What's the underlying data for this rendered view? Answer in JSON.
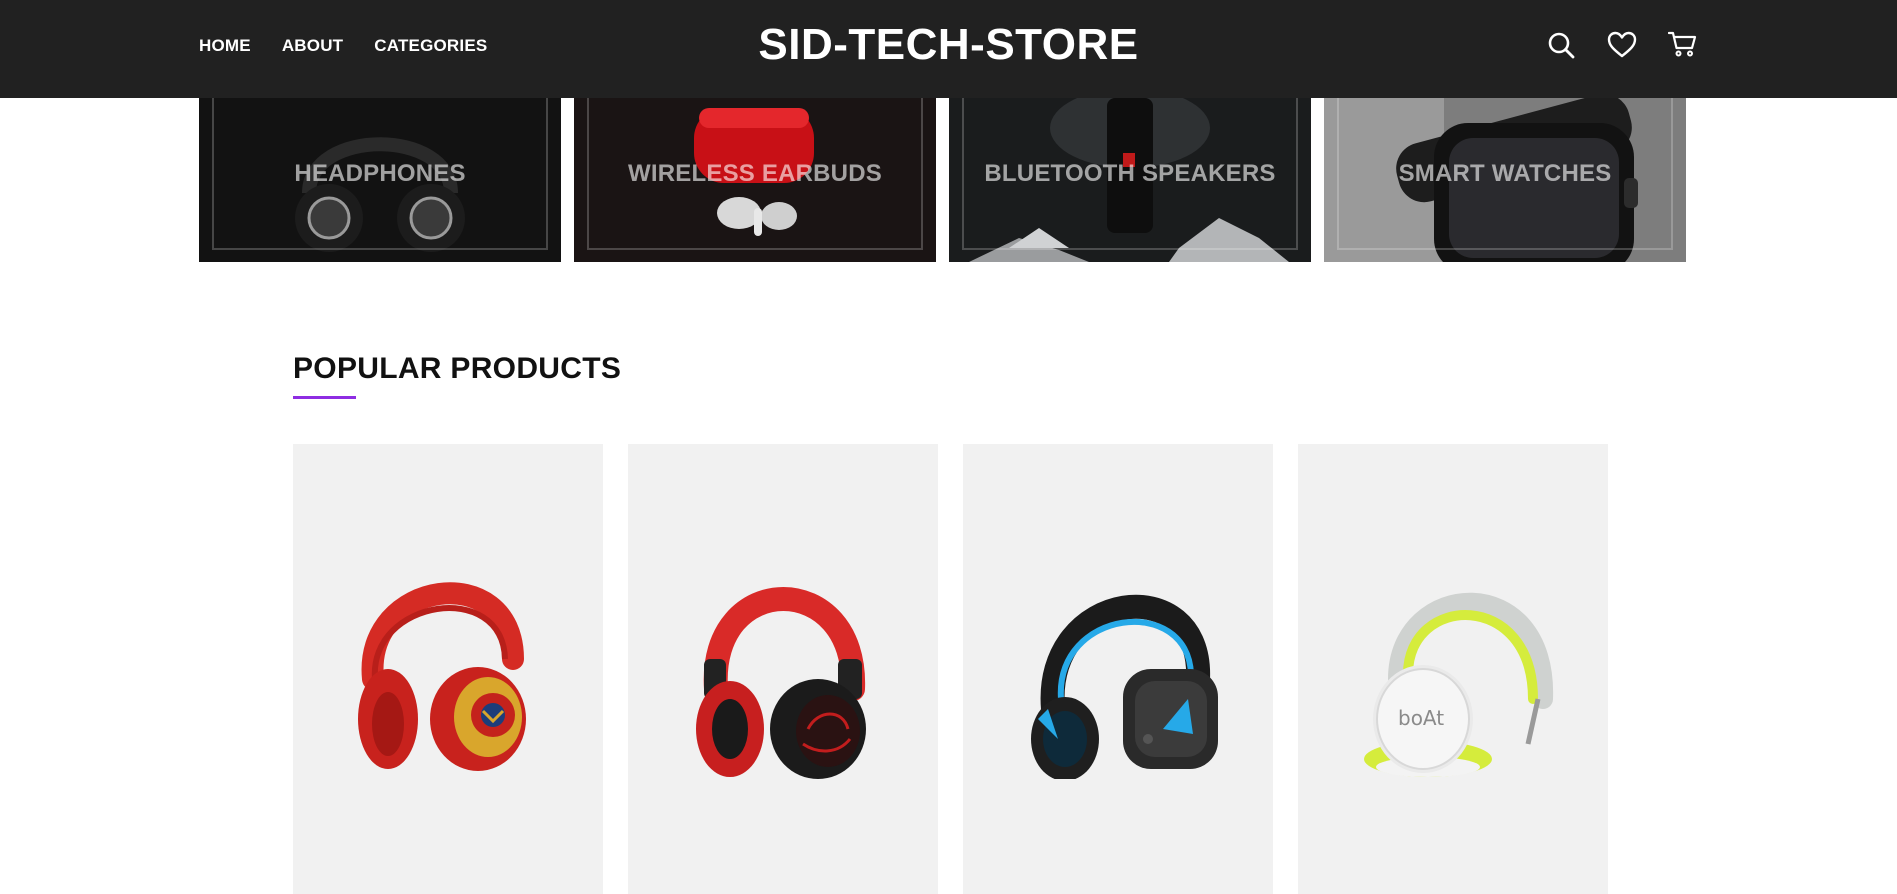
{
  "header": {
    "nav": [
      "HOME",
      "ABOUT",
      "CATEGORIES"
    ],
    "logo": "SID-TECH-STORE",
    "icons": [
      "search-icon",
      "heart-icon",
      "cart-icon"
    ]
  },
  "categories": [
    {
      "label": "HEADPHONES"
    },
    {
      "label": "WIRELESS EARBUDS"
    },
    {
      "label": "BLUETOOTH SPEAKERS"
    },
    {
      "label": "SMART WATCHES"
    }
  ],
  "popular": {
    "title": "POPULAR PRODUCTS"
  },
  "products": [
    {
      "image": "red-gold-headphones-image"
    },
    {
      "image": "red-black-headphones-image"
    },
    {
      "image": "blue-black-headphones-image"
    },
    {
      "image": "white-lime-headphones-image",
      "brand_mark": "boAt"
    }
  ],
  "colors": {
    "header_bg": "#212121",
    "accent_underline": "#8e2de2",
    "card_bg": "#f1f1f1"
  }
}
